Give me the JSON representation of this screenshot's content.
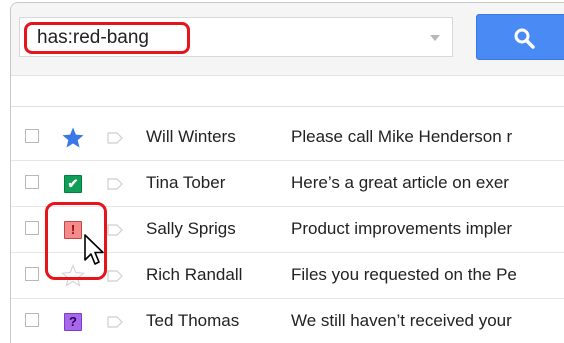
{
  "search": {
    "query": "has:red-bang",
    "button_icon": "search-icon"
  },
  "colors": {
    "highlight": "#e8141b",
    "search_button": "#4a8af4",
    "star_blue": "#3b78e7",
    "check_green": "#0f9d58",
    "red_bang": "#f28c8c",
    "purple_question": "#a868ec"
  },
  "messages": [
    {
      "sender": "Will Winters",
      "subject": "Please call Mike Henderson r",
      "marker": "blue-star-icon"
    },
    {
      "sender": "Tina Tober",
      "subject": "Here’s a great article on exer",
      "marker": "green-check-icon"
    },
    {
      "sender": "Sally Sprigs",
      "subject": "Product improvements impler",
      "marker": "red-bang-icon"
    },
    {
      "sender": "Rich Randall",
      "subject": "Files you requested on the Pe",
      "marker": "empty-star-icon"
    },
    {
      "sender": "Ted Thomas",
      "subject": "We still haven’t received your",
      "marker": "purple-question-icon"
    }
  ],
  "glyphs": {
    "bang": "!",
    "check": "✔",
    "question": "?"
  }
}
